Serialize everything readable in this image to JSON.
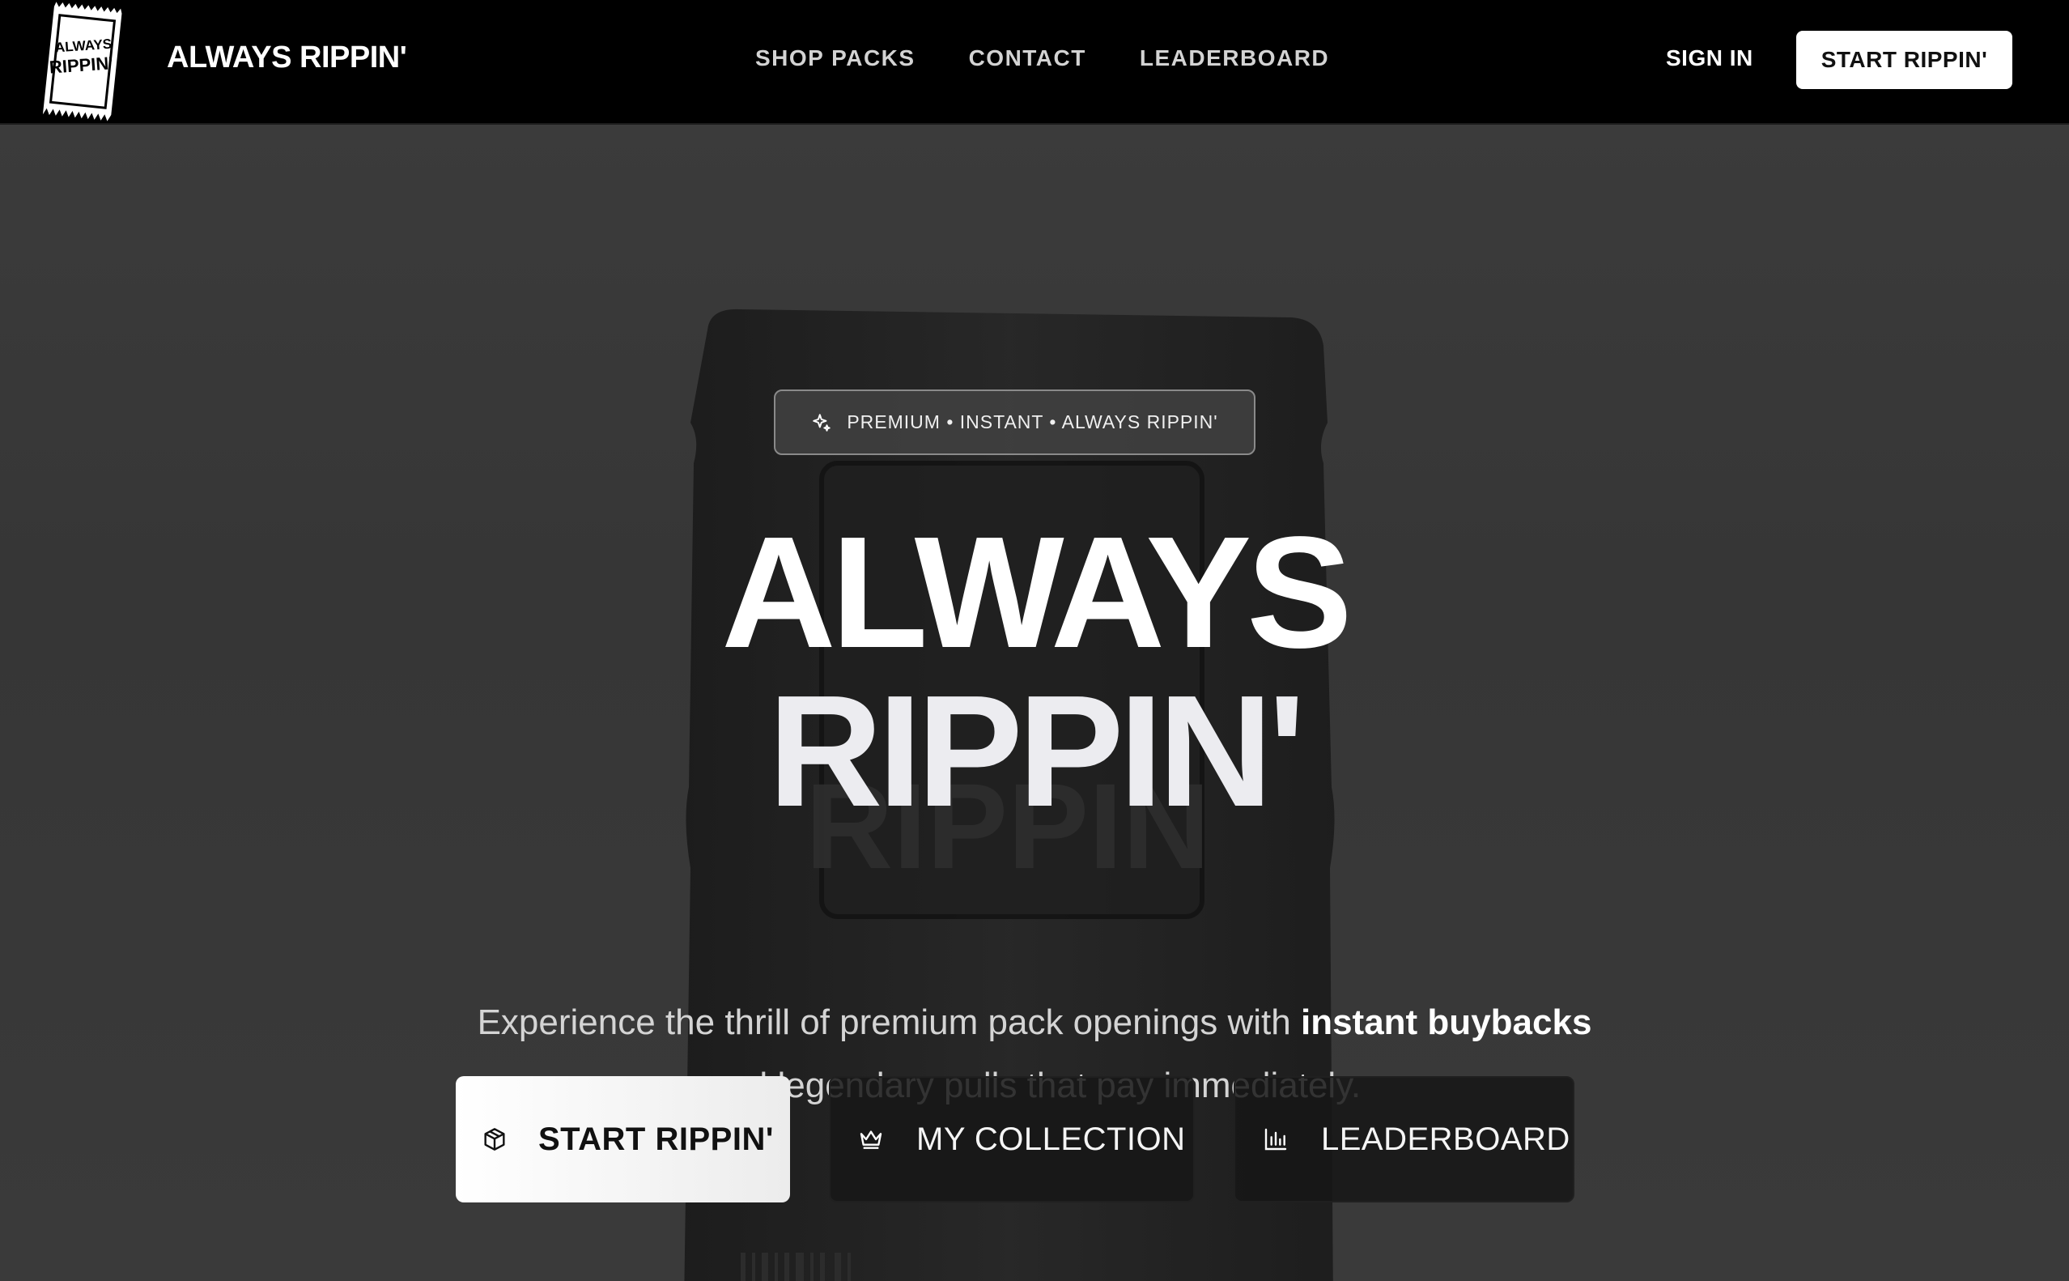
{
  "nav": {
    "logo_text": [
      "ALWAYS",
      "RIPPIN'"
    ],
    "brand": "ALWAYS RIPPIN'",
    "links": [
      "SHOP PACKS",
      "CONTACT",
      "LEADERBOARD"
    ],
    "sign_in": "SIGN IN",
    "cta": "START RIPPIN'"
  },
  "hero": {
    "badge": "PREMIUM • INSTANT • ALWAYS RIPPIN'",
    "headline_line1": "ALWAYS",
    "headline_line2": "RIPPIN'",
    "subtitle_part1": "Experience the thrill of premium pack openings with ",
    "subtitle_bold": "instant buybacks",
    "subtitle_part2": " and legendary pulls that pay immediately.",
    "pack_print": "RIPPIN",
    "buttons": {
      "start": "START RIPPIN'",
      "collection": "MY COLLECTION",
      "leaderboard": "LEADERBOARD"
    }
  },
  "colors": {
    "nav_bg": "#000000",
    "hero_bg": "#3a3a3a",
    "primary_button": "#ffffff",
    "dark_button": "#161616"
  },
  "icons": {
    "badge": "sparkle-icon",
    "start": "box-icon",
    "collection": "crown-icon",
    "leaderboard": "bar-chart-icon"
  }
}
